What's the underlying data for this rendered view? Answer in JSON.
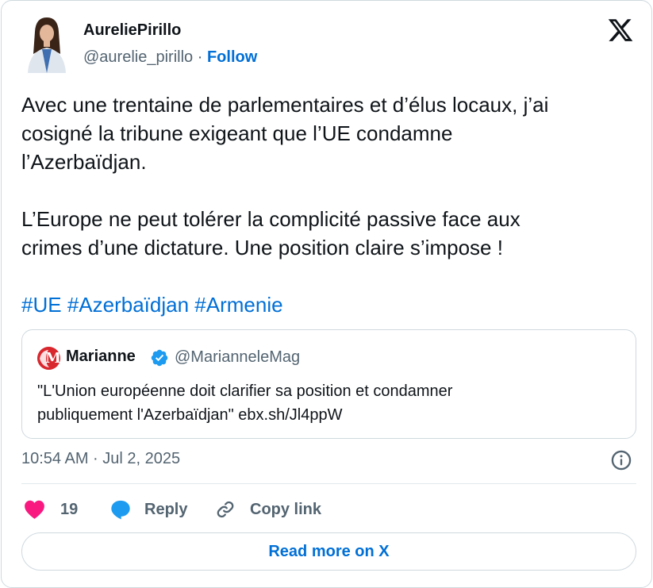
{
  "author": {
    "name": "AureliePirillo",
    "handle": "@aurelie_pirillo",
    "separator": "·",
    "follow_label": "Follow"
  },
  "tweet": {
    "line1": "Avec une trentaine de parlementaires et d’élus locaux, j’ai",
    "line2": "cosigné la tribune exigeant que l’UE condamne",
    "line3": "l’Azerbaïdjan.",
    "line4": "L’Europe ne peut tolérer la complicité passive face aux",
    "line5": "crimes d’une dictature. Une position claire s’impose !",
    "hashtags": [
      "#UE",
      "#Azerbaïdjan",
      "#Armenie"
    ]
  },
  "quote": {
    "name": "Marianne",
    "handle": "@MarianneleMag",
    "line1": "\"L'Union européenne doit clarifier sa position et condamner",
    "line2": "publiquement l'Azerbaïdjan\" ebx.sh/Jl4ppW",
    "logo_letter": "M"
  },
  "timestamp": "10:54 AM · Jul 2, 2025",
  "actions": {
    "like_count": "19",
    "reply_label": "Reply",
    "copy_label": "Copy link"
  },
  "read_more_label": "Read more on X",
  "colors": {
    "accent": "#006fd6",
    "like": "#f91880",
    "reply": "#1d9bf0",
    "muted": "#536471",
    "border": "#cfd9de",
    "marianne_red": "#d9272e"
  }
}
